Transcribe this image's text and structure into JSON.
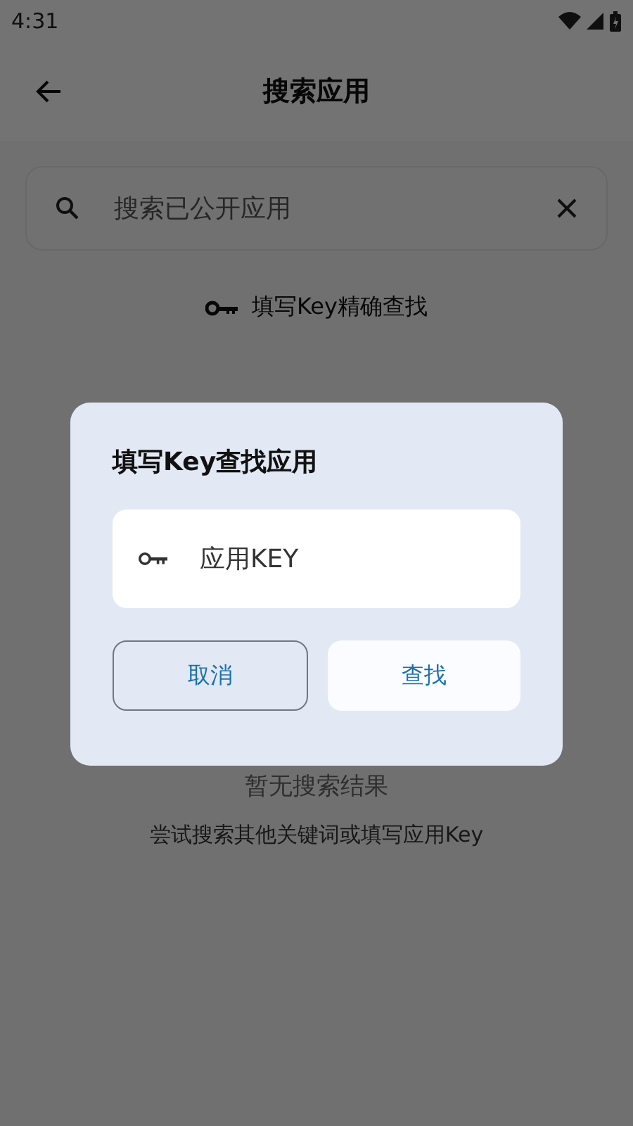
{
  "status_bar": {
    "time": "4:31"
  },
  "app_bar": {
    "title": "搜索应用"
  },
  "search": {
    "placeholder": "搜索已公开应用"
  },
  "key_link": {
    "label": "填写Key精确查找"
  },
  "empty_state": {
    "title": "暂无搜索结果",
    "hint": "尝试搜索其他关键词或填写应用Key"
  },
  "dialog": {
    "title": "填写Key查找应用",
    "field": {
      "placeholder": "应用KEY"
    },
    "buttons": [
      {
        "label": "取消",
        "kind": "outlined"
      },
      {
        "label": "查找",
        "kind": "filled"
      }
    ]
  }
}
